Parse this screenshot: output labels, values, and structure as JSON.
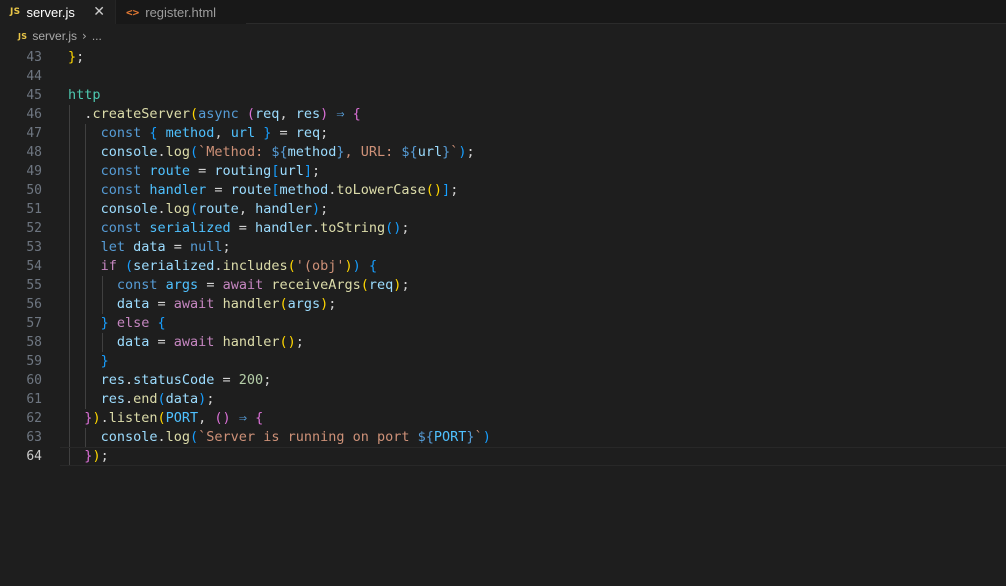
{
  "tabs": [
    {
      "icon": "JS",
      "label": "server.js",
      "active": true,
      "close": "✕"
    },
    {
      "icon": "<>",
      "label": "register.html",
      "active": false
    }
  ],
  "breadcrumb": {
    "icon": "JS",
    "file": "server.js",
    "separator": "›",
    "rest": "..."
  },
  "editor": {
    "current_line": 64,
    "lines": [
      {
        "n": "43",
        "indent": 0,
        "tokens": [
          [
            "p1",
            "}"
          ],
          [
            "punc",
            ";"
          ]
        ]
      },
      {
        "n": "44",
        "indent": 0,
        "tokens": []
      },
      {
        "n": "45",
        "indent": 0,
        "tokens": [
          [
            "obj",
            "http"
          ]
        ]
      },
      {
        "n": "46",
        "indent": 1,
        "tokens": [
          [
            "punc",
            "."
          ],
          [
            "fn",
            "createServer"
          ],
          [
            "p1",
            "("
          ],
          [
            "kw",
            "async"
          ],
          [
            "plain",
            " "
          ],
          [
            "p2",
            "("
          ],
          [
            "var",
            "req"
          ],
          [
            "punc",
            ", "
          ],
          [
            "var",
            "res"
          ],
          [
            "p2",
            ")"
          ],
          [
            "plain",
            " "
          ],
          [
            "kw",
            "⇒"
          ],
          [
            "plain",
            " "
          ],
          [
            "p2",
            "{"
          ]
        ]
      },
      {
        "n": "47",
        "indent": 2,
        "tokens": [
          [
            "kw",
            "const"
          ],
          [
            "plain",
            " "
          ],
          [
            "p3",
            "{"
          ],
          [
            "plain",
            " "
          ],
          [
            "const",
            "method"
          ],
          [
            "punc",
            ", "
          ],
          [
            "const",
            "url"
          ],
          [
            "plain",
            " "
          ],
          [
            "p3",
            "}"
          ],
          [
            "plain",
            " = "
          ],
          [
            "var",
            "req"
          ],
          [
            "punc",
            ";"
          ]
        ]
      },
      {
        "n": "48",
        "indent": 2,
        "tokens": [
          [
            "var",
            "console"
          ],
          [
            "punc",
            "."
          ],
          [
            "fn",
            "log"
          ],
          [
            "p3",
            "("
          ],
          [
            "str",
            "`Method: "
          ],
          [
            "interp",
            "${"
          ],
          [
            "var",
            "method"
          ],
          [
            "interp",
            "}"
          ],
          [
            "str",
            ", URL: "
          ],
          [
            "interp",
            "${"
          ],
          [
            "var",
            "url"
          ],
          [
            "interp",
            "}"
          ],
          [
            "str",
            "`"
          ],
          [
            "p3",
            ")"
          ],
          [
            "punc",
            ";"
          ]
        ]
      },
      {
        "n": "49",
        "indent": 2,
        "tokens": [
          [
            "kw",
            "const"
          ],
          [
            "plain",
            " "
          ],
          [
            "const",
            "route"
          ],
          [
            "plain",
            " = "
          ],
          [
            "var",
            "routing"
          ],
          [
            "p3",
            "["
          ],
          [
            "var",
            "url"
          ],
          [
            "p3",
            "]"
          ],
          [
            "punc",
            ";"
          ]
        ]
      },
      {
        "n": "50",
        "indent": 2,
        "tokens": [
          [
            "kw",
            "const"
          ],
          [
            "plain",
            " "
          ],
          [
            "const",
            "handler"
          ],
          [
            "plain",
            " = "
          ],
          [
            "var",
            "route"
          ],
          [
            "p3",
            "["
          ],
          [
            "var",
            "method"
          ],
          [
            "punc",
            "."
          ],
          [
            "fn",
            "toLowerCase"
          ],
          [
            "p1",
            "()"
          ],
          [
            "p3",
            "]"
          ],
          [
            "punc",
            ";"
          ]
        ]
      },
      {
        "n": "51",
        "indent": 2,
        "tokens": [
          [
            "var",
            "console"
          ],
          [
            "punc",
            "."
          ],
          [
            "fn",
            "log"
          ],
          [
            "p3",
            "("
          ],
          [
            "var",
            "route"
          ],
          [
            "punc",
            ", "
          ],
          [
            "var",
            "handler"
          ],
          [
            "p3",
            ")"
          ],
          [
            "punc",
            ";"
          ]
        ]
      },
      {
        "n": "52",
        "indent": 2,
        "tokens": [
          [
            "kw",
            "const"
          ],
          [
            "plain",
            " "
          ],
          [
            "const",
            "serialized"
          ],
          [
            "plain",
            " = "
          ],
          [
            "var",
            "handler"
          ],
          [
            "punc",
            "."
          ],
          [
            "fn",
            "toString"
          ],
          [
            "p3",
            "()"
          ],
          [
            "punc",
            ";"
          ]
        ]
      },
      {
        "n": "53",
        "indent": 2,
        "tokens": [
          [
            "kw",
            "let"
          ],
          [
            "plain",
            " "
          ],
          [
            "var",
            "data"
          ],
          [
            "plain",
            " = "
          ],
          [
            "kw",
            "null"
          ],
          [
            "punc",
            ";"
          ]
        ]
      },
      {
        "n": "54",
        "indent": 2,
        "tokens": [
          [
            "ctl",
            "if"
          ],
          [
            "plain",
            " "
          ],
          [
            "p3",
            "("
          ],
          [
            "var",
            "serialized"
          ],
          [
            "punc",
            "."
          ],
          [
            "fn",
            "includes"
          ],
          [
            "p1",
            "("
          ],
          [
            "str",
            "'(obj'"
          ],
          [
            "p1",
            ")"
          ],
          [
            "p3",
            ")"
          ],
          [
            "plain",
            " "
          ],
          [
            "p3",
            "{"
          ]
        ]
      },
      {
        "n": "55",
        "indent": 3,
        "tokens": [
          [
            "kw",
            "const"
          ],
          [
            "plain",
            " "
          ],
          [
            "const",
            "args"
          ],
          [
            "plain",
            " = "
          ],
          [
            "ctl",
            "await"
          ],
          [
            "plain",
            " "
          ],
          [
            "fn",
            "receiveArgs"
          ],
          [
            "p1",
            "("
          ],
          [
            "var",
            "req"
          ],
          [
            "p1",
            ")"
          ],
          [
            "punc",
            ";"
          ]
        ]
      },
      {
        "n": "56",
        "indent": 3,
        "tokens": [
          [
            "var",
            "data"
          ],
          [
            "plain",
            " = "
          ],
          [
            "ctl",
            "await"
          ],
          [
            "plain",
            " "
          ],
          [
            "fn",
            "handler"
          ],
          [
            "p1",
            "("
          ],
          [
            "var",
            "args"
          ],
          [
            "p1",
            ")"
          ],
          [
            "punc",
            ";"
          ]
        ]
      },
      {
        "n": "57",
        "indent": 2,
        "tokens": [
          [
            "p3",
            "}"
          ],
          [
            "plain",
            " "
          ],
          [
            "ctl",
            "else"
          ],
          [
            "plain",
            " "
          ],
          [
            "p3",
            "{"
          ]
        ]
      },
      {
        "n": "58",
        "indent": 3,
        "tokens": [
          [
            "var",
            "data"
          ],
          [
            "plain",
            " = "
          ],
          [
            "ctl",
            "await"
          ],
          [
            "plain",
            " "
          ],
          [
            "fn",
            "handler"
          ],
          [
            "p1",
            "()"
          ],
          [
            "punc",
            ";"
          ]
        ]
      },
      {
        "n": "59",
        "indent": 2,
        "tokens": [
          [
            "p3",
            "}"
          ]
        ]
      },
      {
        "n": "60",
        "indent": 2,
        "tokens": [
          [
            "var",
            "res"
          ],
          [
            "punc",
            "."
          ],
          [
            "var",
            "statusCode"
          ],
          [
            "plain",
            " = "
          ],
          [
            "num",
            "200"
          ],
          [
            "punc",
            ";"
          ]
        ]
      },
      {
        "n": "61",
        "indent": 2,
        "tokens": [
          [
            "var",
            "res"
          ],
          [
            "punc",
            "."
          ],
          [
            "fn",
            "end"
          ],
          [
            "p3",
            "("
          ],
          [
            "var",
            "data"
          ],
          [
            "p3",
            ")"
          ],
          [
            "punc",
            ";"
          ]
        ]
      },
      {
        "n": "62",
        "indent": 1,
        "tokens": [
          [
            "p2",
            "}"
          ],
          [
            "p1",
            ")"
          ],
          [
            "punc",
            "."
          ],
          [
            "fn",
            "listen"
          ],
          [
            "p1",
            "("
          ],
          [
            "const",
            "PORT"
          ],
          [
            "punc",
            ", "
          ],
          [
            "p2",
            "()"
          ],
          [
            "plain",
            " "
          ],
          [
            "kw",
            "⇒"
          ],
          [
            "plain",
            " "
          ],
          [
            "p2",
            "{"
          ]
        ]
      },
      {
        "n": "63",
        "indent": 2,
        "tokens": [
          [
            "var",
            "console"
          ],
          [
            "punc",
            "."
          ],
          [
            "fn",
            "log"
          ],
          [
            "p3",
            "("
          ],
          [
            "str",
            "`Server is running on port "
          ],
          [
            "interp",
            "${"
          ],
          [
            "const",
            "PORT"
          ],
          [
            "interp",
            "}"
          ],
          [
            "str",
            "`"
          ],
          [
            "p3",
            ")"
          ]
        ]
      },
      {
        "n": "64",
        "indent": 1,
        "tokens": [
          [
            "p2",
            "}"
          ],
          [
            "p1",
            ")"
          ],
          [
            "punc",
            ";"
          ]
        ]
      }
    ]
  }
}
